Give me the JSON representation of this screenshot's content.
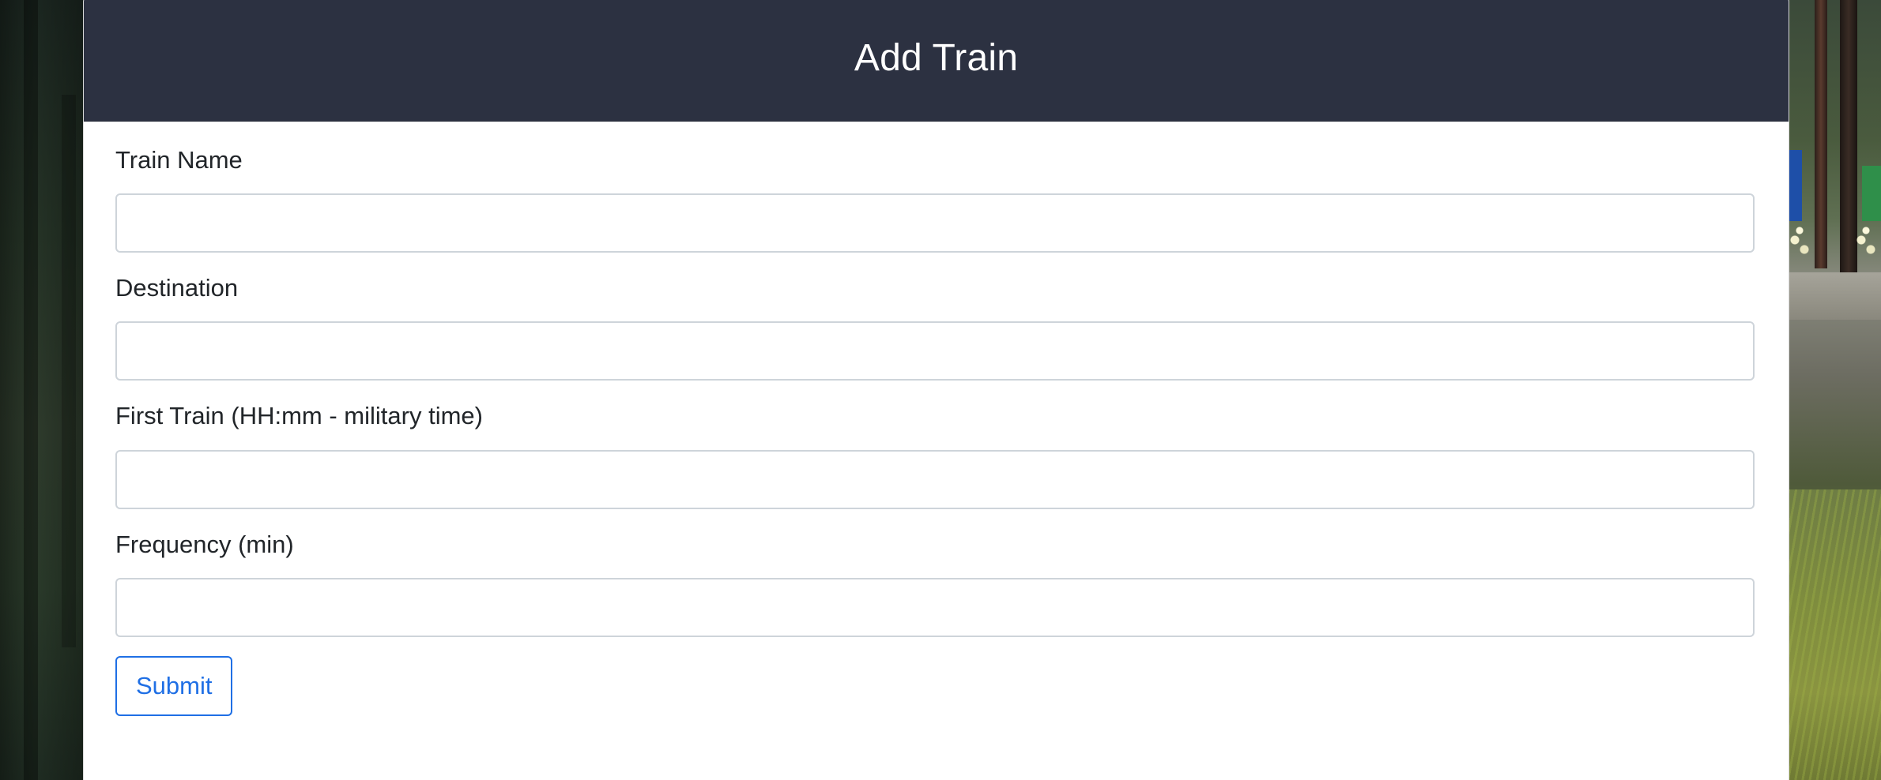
{
  "form": {
    "title": "Add Train",
    "fields": [
      {
        "label": "Train Name",
        "value": "",
        "placeholder": ""
      },
      {
        "label": "Destination",
        "value": "",
        "placeholder": ""
      },
      {
        "label": "First Train (HH:mm - military time)",
        "value": "",
        "placeholder": ""
      },
      {
        "label": "Frequency (min)",
        "value": "",
        "placeholder": ""
      }
    ],
    "submit_label": "Submit"
  },
  "colors": {
    "header_bg": "#2c3141",
    "accent": "#1f6fe5"
  }
}
